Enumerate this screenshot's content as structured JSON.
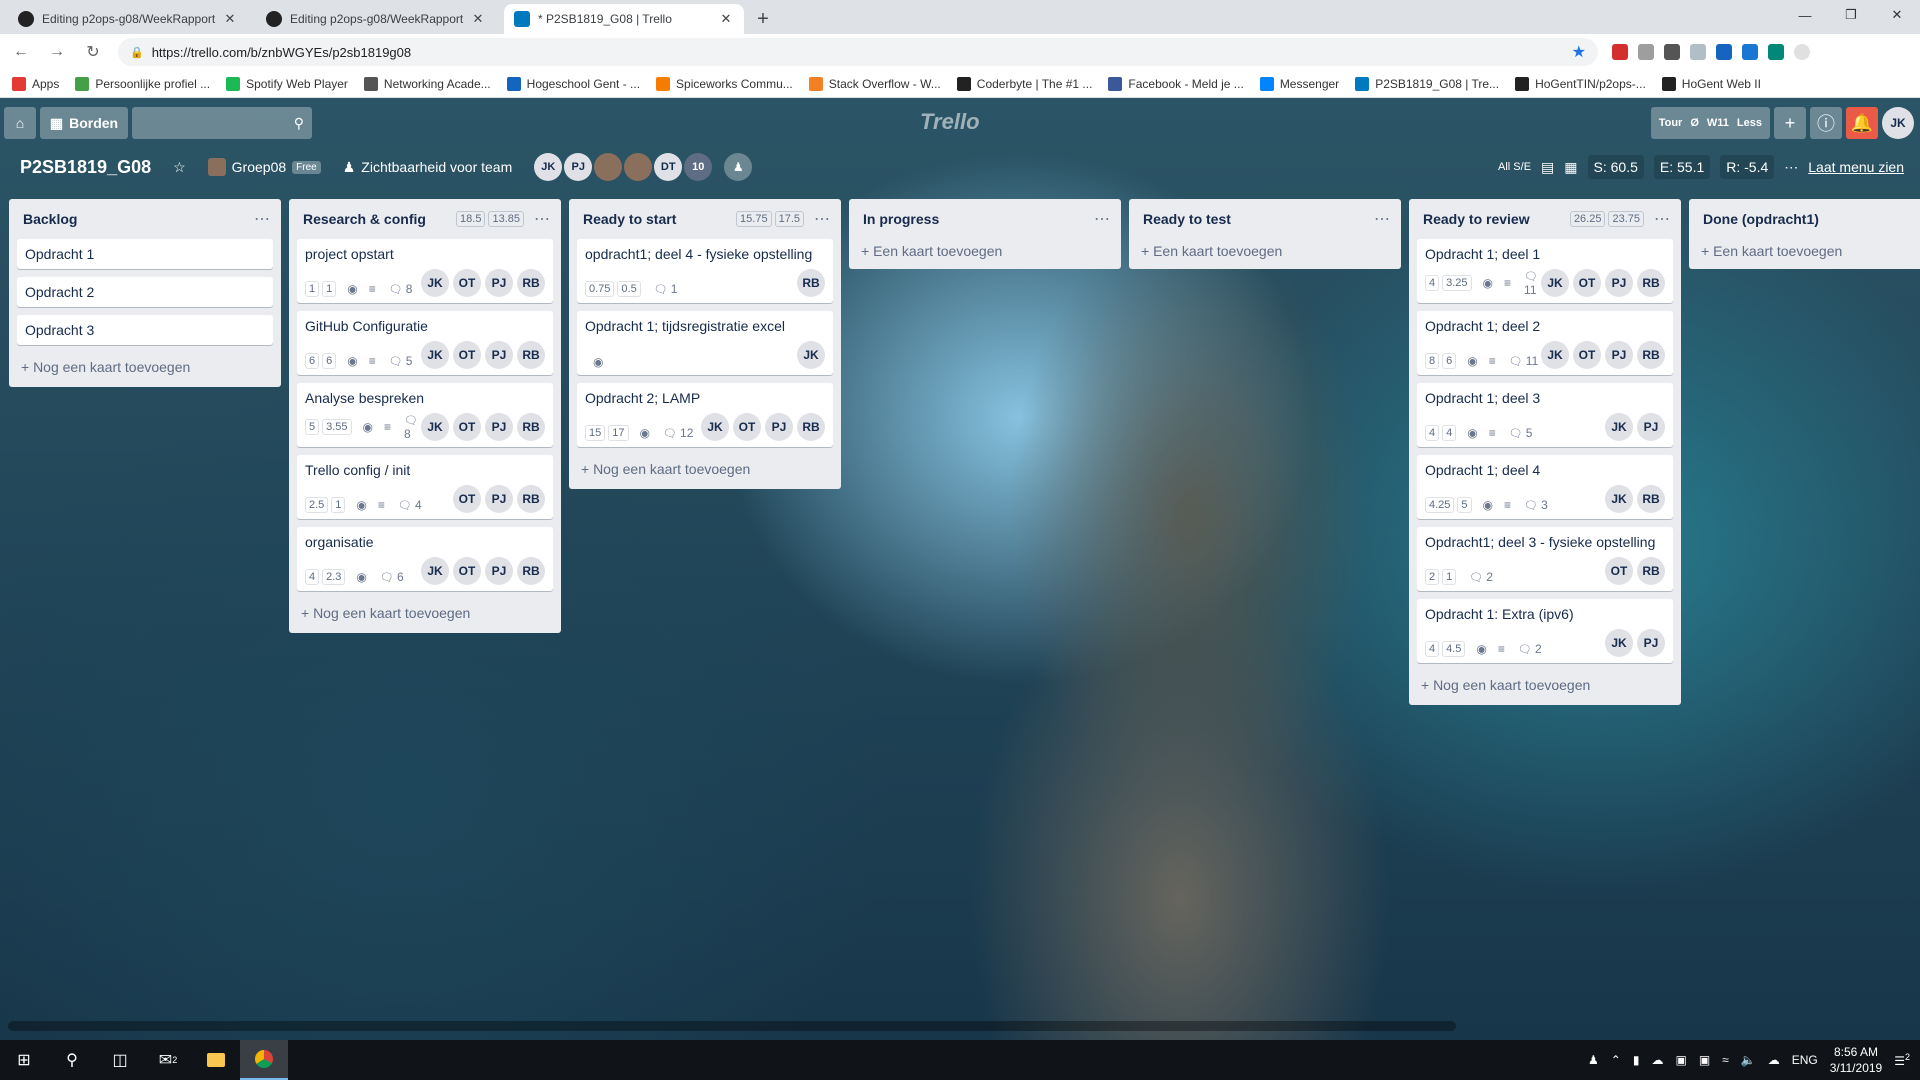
{
  "browser": {
    "tabs": [
      {
        "title": "Editing p2ops-g08/WeekRapport",
        "active": false
      },
      {
        "title": "Editing p2ops-g08/WeekRapport",
        "active": false
      },
      {
        "title": "* P2SB1819_G08 | Trello",
        "active": true
      }
    ],
    "url": "https://trello.com/b/znbWGYEs/p2sb1819g08",
    "bookmarks": [
      "Apps",
      "Persoonlijke profiel ...",
      "Spotify Web Player",
      "Networking Acade...",
      "Hogeschool Gent - ...",
      "Spiceworks Commu...",
      "Stack Overflow - W...",
      "Coderbyte | The #1 ...",
      "Facebook - Meld je ...",
      "Messenger",
      "P2SB1819_G08 | Tre...",
      "HoGentTIN/p2ops-...",
      "HoGent Web II"
    ]
  },
  "trello": {
    "borden_label": "Borden",
    "logo": "Trello",
    "tour": "Tour",
    "week": "W11",
    "less": "Less",
    "zero": "Ø",
    "user": "JK"
  },
  "board": {
    "title": "P2SB1819_G08",
    "team": "Groep08",
    "team_badge": "Free",
    "visibility": "Zichtbaarheid voor team",
    "members": [
      "JK",
      "PJ",
      "",
      "",
      "DT",
      "10"
    ],
    "all_label": "All S/E",
    "s": "S: 60.5",
    "e": "E: 55.1",
    "r": "R: -5.4",
    "menu": "Laat menu zien"
  },
  "lists": [
    {
      "title": "Backlog",
      "badges": [],
      "add": "+ Nog een kaart toevoegen",
      "cards": [
        {
          "title": "Opdracht 1",
          "badges": [],
          "watch": false,
          "desc": false,
          "comments": "",
          "members": []
        },
        {
          "title": "Opdracht 2",
          "badges": [],
          "watch": false,
          "desc": false,
          "comments": "",
          "members": []
        },
        {
          "title": "Opdracht 3",
          "badges": [],
          "watch": false,
          "desc": false,
          "comments": "",
          "members": []
        }
      ]
    },
    {
      "title": "Research & config",
      "badges": [
        "18.5",
        "13.85"
      ],
      "add": "+ Nog een kaart toevoegen",
      "cards": [
        {
          "title": "project opstart",
          "badges": [
            "1",
            "1"
          ],
          "watch": true,
          "desc": true,
          "comments": "8",
          "members": [
            "JK",
            "OT",
            "PJ",
            "RB"
          ]
        },
        {
          "title": "GitHub Configuratie",
          "badges": [
            "6",
            "6"
          ],
          "watch": true,
          "desc": true,
          "comments": "5",
          "members": [
            "JK",
            "OT",
            "PJ",
            "RB"
          ]
        },
        {
          "title": "Analyse bespreken",
          "badges": [
            "5",
            "3.55"
          ],
          "watch": true,
          "desc": true,
          "comments": "8",
          "members": [
            "JK",
            "OT",
            "PJ",
            "RB"
          ]
        },
        {
          "title": "Trello config / init",
          "badges": [
            "2.5",
            "1"
          ],
          "watch": true,
          "desc": true,
          "comments": "4",
          "members": [
            "OT",
            "PJ",
            "RB"
          ]
        },
        {
          "title": "organisatie",
          "badges": [
            "4",
            "2.3"
          ],
          "watch": true,
          "desc": false,
          "comments": "6",
          "members": [
            "JK",
            "OT",
            "PJ",
            "RB"
          ]
        }
      ]
    },
    {
      "title": "Ready to start",
      "badges": [
        "15.75",
        "17.5"
      ],
      "add": "+ Nog een kaart toevoegen",
      "cards": [
        {
          "title": "opdracht1; deel 4 - fysieke opstelling",
          "badges": [
            "0.75",
            "0.5"
          ],
          "watch": false,
          "desc": false,
          "comments": "1",
          "members": [
            "RB"
          ]
        },
        {
          "title": "Opdracht 1; tijdsregistratie excel",
          "badges": [],
          "watch": true,
          "desc": false,
          "comments": "",
          "members": [
            "JK"
          ]
        },
        {
          "title": "Opdracht 2; LAMP",
          "badges": [
            "15",
            "17"
          ],
          "watch": true,
          "desc": false,
          "comments": "12",
          "members": [
            "JK",
            "OT",
            "PJ",
            "RB"
          ]
        }
      ]
    },
    {
      "title": "In progress",
      "badges": [],
      "add": "+ Een kaart toevoegen",
      "cards": []
    },
    {
      "title": "Ready to test",
      "badges": [],
      "add": "+ Een kaart toevoegen",
      "cards": []
    },
    {
      "title": "Ready to review",
      "badges": [
        "26.25",
        "23.75"
      ],
      "add": "+ Nog een kaart toevoegen",
      "cards": [
        {
          "title": "Opdracht 1; deel 1",
          "badges": [
            "4",
            "3.25"
          ],
          "watch": true,
          "desc": true,
          "comments": "11",
          "members": [
            "JK",
            "OT",
            "PJ",
            "RB"
          ]
        },
        {
          "title": "Opdracht 1; deel 2",
          "badges": [
            "8",
            "6"
          ],
          "watch": true,
          "desc": true,
          "comments": "11",
          "members": [
            "JK",
            "OT",
            "PJ",
            "RB"
          ]
        },
        {
          "title": "Opdracht 1; deel 3",
          "badges": [
            "4",
            "4"
          ],
          "watch": true,
          "desc": true,
          "comments": "5",
          "members": [
            "JK",
            "PJ"
          ]
        },
        {
          "title": "Opdracht 1; deel 4",
          "badges": [
            "4.25",
            "5"
          ],
          "watch": true,
          "desc": true,
          "comments": "3",
          "members": [
            "JK",
            "RB"
          ]
        },
        {
          "title": "Opdracht1; deel 3 - fysieke opstelling",
          "badges": [
            "2",
            "1"
          ],
          "watch": false,
          "desc": false,
          "comments": "2",
          "members": [
            "OT",
            "RB"
          ]
        },
        {
          "title": "Opdracht 1: Extra (ipv6)",
          "badges": [
            "4",
            "4.5"
          ],
          "watch": true,
          "desc": true,
          "comments": "2",
          "members": [
            "JK",
            "PJ"
          ]
        }
      ]
    },
    {
      "title": "Done (opdracht1)",
      "badges": [],
      "add": "+ Een kaart toevoegen",
      "cards": []
    }
  ],
  "taskbar": {
    "lang": "ENG",
    "time": "8:56 AM",
    "date": "3/11/2019",
    "mail_count": "2",
    "notif_count": "2"
  }
}
